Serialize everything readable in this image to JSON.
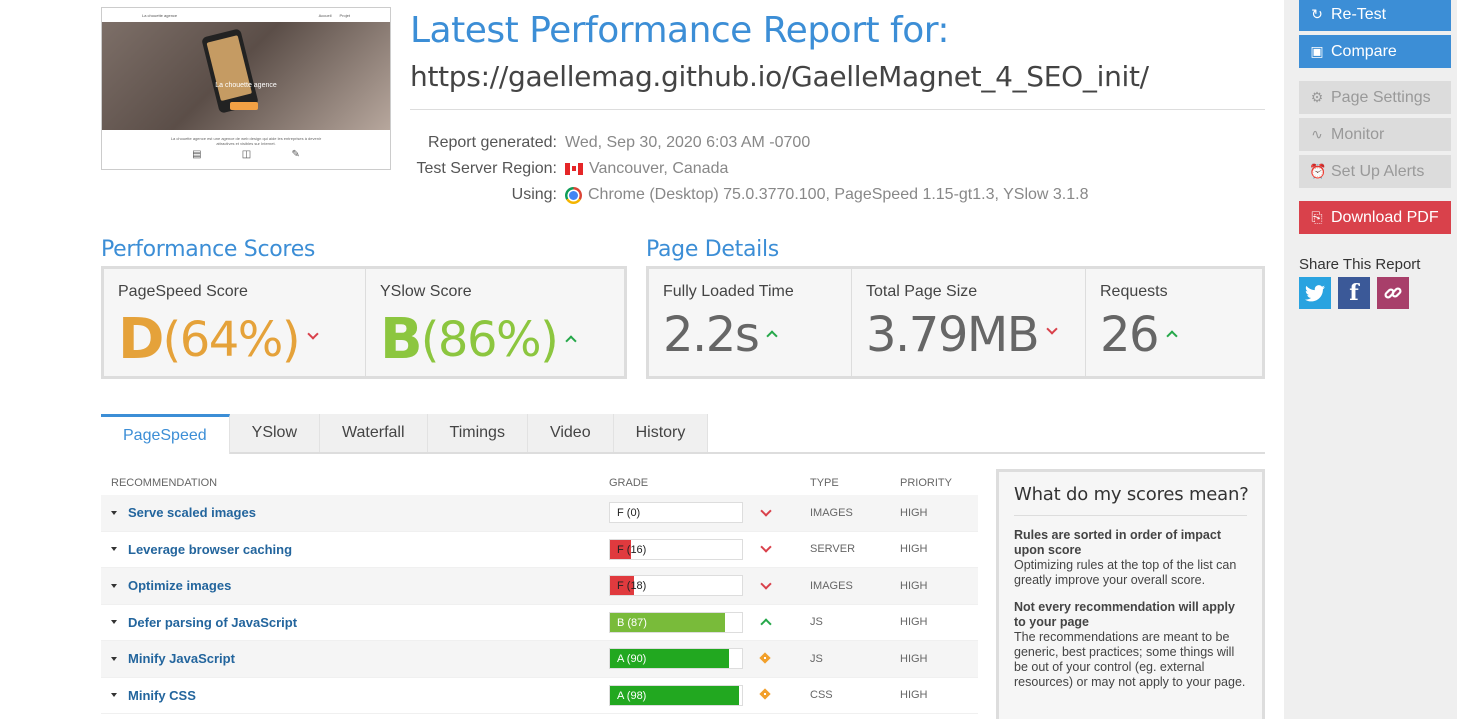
{
  "header": {
    "title": "Latest Performance Report for:",
    "url": "https://gaellemag.github.io/GaelleMagnet_4_SEO_init/",
    "thumbnail": {
      "brand": "La chouette agence",
      "nav": [
        "Accueil",
        "Projet"
      ],
      "hero_title": "La chouette agence",
      "body": "La chouette agence est une agence de web design qui aide les entreprises à devenir attractives et visibles sur Internet."
    },
    "meta": [
      {
        "label": "Report generated:",
        "value": "Wed, Sep 30, 2020 6:03 AM -0700",
        "icon": ""
      },
      {
        "label": "Test Server Region:",
        "value": "Vancouver, Canada",
        "icon": "canada-flag-icon"
      },
      {
        "label": "Using:",
        "value": "Chrome (Desktop) 75.0.3770.100, PageSpeed 1.15-gt1.3, YSlow 3.1.8",
        "icon": "chrome-icon"
      }
    ]
  },
  "performance": {
    "title": "Performance Scores",
    "pagespeed": {
      "label": "PageSpeed Score",
      "grade": "D",
      "percent": "(64%)",
      "trend": "down",
      "color": "#e5a23a"
    },
    "yslow": {
      "label": "YSlow Score",
      "grade": "B",
      "percent": "(86%)",
      "trend": "up",
      "color": "#8cc63f"
    }
  },
  "details": {
    "title": "Page Details",
    "loaded": {
      "label": "Fully Loaded Time",
      "value": "2.2s",
      "trend": "up"
    },
    "size": {
      "label": "Total Page Size",
      "value": "3.79MB",
      "trend": "down"
    },
    "requests": {
      "label": "Requests",
      "value": "26",
      "trend": "up"
    }
  },
  "tabs": [
    "PageSpeed",
    "YSlow",
    "Waterfall",
    "Timings",
    "Video",
    "History"
  ],
  "active_tab": "PageSpeed",
  "table": {
    "headers": {
      "recommendation": "RECOMMENDATION",
      "grade": "GRADE",
      "type": "TYPE",
      "priority": "PRIORITY"
    },
    "rows": [
      {
        "name": "Serve scaled images",
        "grade": "F (0)",
        "score": 0,
        "color": "#e03a3e",
        "trend": "down",
        "type": "IMAGES",
        "priority": "HIGH"
      },
      {
        "name": "Leverage browser caching",
        "grade": "F (16)",
        "score": 16,
        "color": "#e03a3e",
        "trend": "down",
        "type": "SERVER",
        "priority": "HIGH"
      },
      {
        "name": "Optimize images",
        "grade": "F (18)",
        "score": 18,
        "color": "#e03a3e",
        "trend": "down",
        "type": "IMAGES",
        "priority": "HIGH"
      },
      {
        "name": "Defer parsing of JavaScript",
        "grade": "B (87)",
        "score": 87,
        "color": "#79bb3a",
        "trend": "up",
        "type": "JS",
        "priority": "HIGH"
      },
      {
        "name": "Minify JavaScript",
        "grade": "A (90)",
        "score": 90,
        "color": "#22a820",
        "trend": "diamond",
        "type": "JS",
        "priority": "HIGH"
      },
      {
        "name": "Minify CSS",
        "grade": "A (98)",
        "score": 98,
        "color": "#22a820",
        "trend": "diamond",
        "type": "CSS",
        "priority": "HIGH"
      }
    ]
  },
  "info": {
    "title": "What do my scores mean?",
    "p1_bold": "Rules are sorted in order of impact upon score",
    "p1": "Optimizing rules at the top of the list can greatly improve your overall score.",
    "p2_bold": "Not every recommendation will apply to your page",
    "p2": "The recommendations are meant to be generic, best practices; some things will be out of your control (eg. external resources) or may not apply to your page."
  },
  "sidebar": {
    "retest": "Re-Test",
    "compare": "Compare",
    "page_settings": "Page Settings",
    "monitor": "Monitor",
    "alerts": "Set Up Alerts",
    "download": "Download PDF",
    "share_label": "Share This Report",
    "share_colors": {
      "twitter": "#29a3e0",
      "facebook": "#3b5998",
      "link": "#a83f6a"
    }
  },
  "colors": {
    "accent": "#3c8ed6",
    "danger": "#d9414b",
    "success": "#26a84a"
  }
}
